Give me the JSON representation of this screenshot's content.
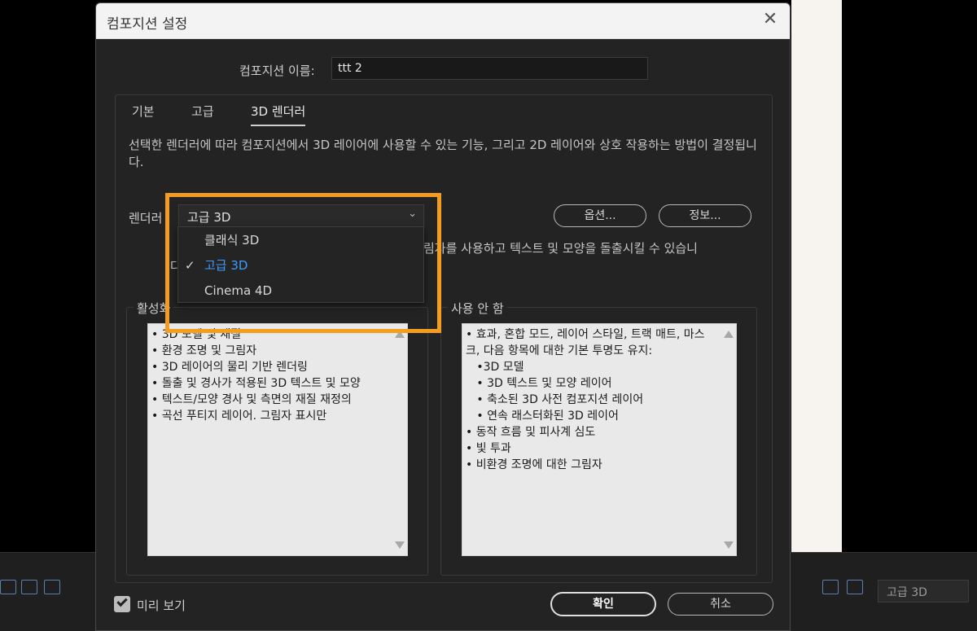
{
  "dialog": {
    "title": "컴포지션 설정",
    "close_icon": "close-icon",
    "name_label": "컴포지션 이름:",
    "name_value": "ttt 2",
    "tabs": [
      {
        "label": "기본"
      },
      {
        "label": "고급"
      },
      {
        "label": "3D 렌더러",
        "active": true
      }
    ],
    "description": "선택한 렌더러에 따라 컴포지션에서 3D 레이어에 사용할 수 있는 기능, 그리고 2D 레이어와 상호 작용하는 방법이 결정됩니다.",
    "renderer_label": "렌더러",
    "renderer_value": "고급 3D",
    "options_button": "옵션...",
    "info_button": "정보...",
    "partial_hint_text": "림자를 사용하고 텍스트 및 모양을 돌출시킬 수 있습니",
    "partial_hint_text2": "다",
    "enabled_label": "활성화",
    "enabled_items": [
      "• 3D 모델 및 재질",
      "• 환경 조명 및 그림자",
      "• 3D 레이어의 물리 기반 렌더링",
      "• 돌출 및 경사가 적용된 3D 텍스트 및 모양",
      "• 텍스트/모양 경사 및 측면의 재질 재정의",
      "• 곡선 푸티지 레이어. 그림자 표시만"
    ],
    "disabled_label": "사용 안 함",
    "disabled_items": [
      "• 효과, 혼합 모드, 레이어 스타일, 트랙 매트, 마스크, 다음 항목에 대한 기본 투명도 유지:",
      "   •3D 모델",
      "   • 3D 텍스트 및 모양 레이어",
      "   • 축소된 3D 사전 컴포지션 레이어",
      "   • 연속 래스터화된 3D 레이어",
      "• 동작 흐름 및 피사계 심도",
      "• 빛 투과",
      "• 비환경 조명에 대한 그림자"
    ],
    "preview_label": "미리 보기",
    "preview_checked": true,
    "ok_button": "확인",
    "cancel_button": "취소"
  },
  "dropdown": {
    "options": [
      {
        "label": "클래식 3D",
        "selected": false
      },
      {
        "label": "고급 3D",
        "selected": true
      },
      {
        "label": "Cinema 4D",
        "selected": false
      }
    ],
    "selected_color": "#3f9bff"
  },
  "background": {
    "renderer_select": "고급 3D"
  },
  "colors": {
    "highlight": "#f39c1f",
    "dialog_bg": "#232323"
  }
}
